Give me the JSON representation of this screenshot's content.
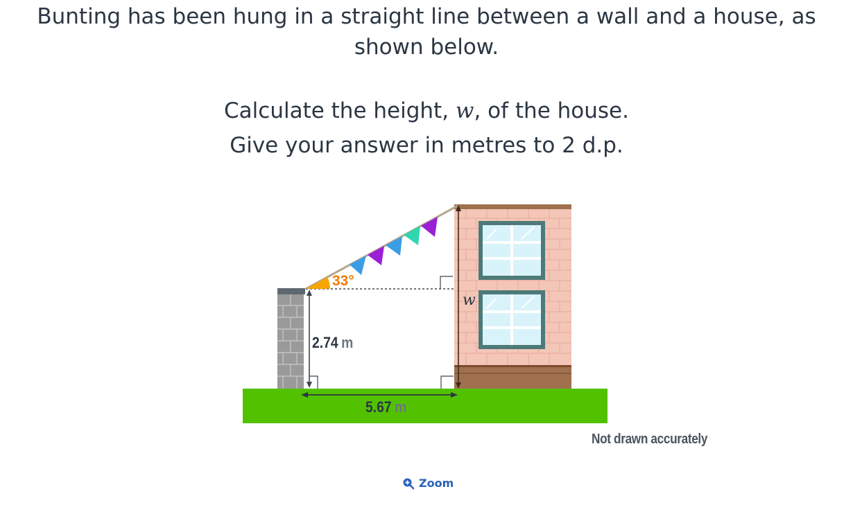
{
  "question": {
    "line1": "Bunting has been hung in a straight line between a wall and a house, as",
    "line2": "shown below.",
    "instruction_before_var": "Calculate the height, ",
    "variable": "w",
    "instruction_after_var": ", of the house.",
    "answer_instruction": "Give your answer in metres to 2 d.p."
  },
  "diagram": {
    "angle_label": "33°",
    "wall_height_value": "2.74",
    "wall_height_unit": "m",
    "distance_value": "5.67",
    "distance_unit": "m",
    "house_height_label": "w",
    "note": "Not drawn accurately",
    "colors": {
      "grass": "#52c200",
      "wall": "#9a9a9a",
      "brick": "#f3c6b8",
      "house_base": "#a0704f",
      "window_glass": "#d9f3fa",
      "window_frame": "#4d7a78",
      "angle_fill": "#f7a600",
      "angle_text": "#ee7d00",
      "flag_blue": "#3a9de6",
      "flag_purple": "#9b1fd6",
      "flag_teal": "#2fd6b0"
    }
  },
  "zoom": {
    "label": "Zoom",
    "icon": "zoom-in-icon"
  }
}
